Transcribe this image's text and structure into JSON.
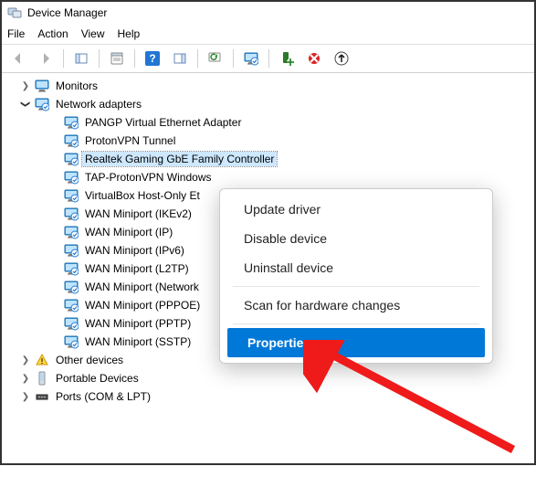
{
  "window": {
    "title": "Device Manager"
  },
  "menu": {
    "file": "File",
    "action": "Action",
    "view": "View",
    "help": "Help"
  },
  "tree": {
    "monitors": "Monitors",
    "network_adapters": "Network adapters",
    "adapters": [
      "PANGP Virtual Ethernet Adapter",
      "ProtonVPN Tunnel",
      "Realtek Gaming GbE Family Controller",
      "TAP-ProtonVPN Windows",
      "VirtualBox Host-Only Et",
      "WAN Miniport (IKEv2)",
      "WAN Miniport (IP)",
      "WAN Miniport (IPv6)",
      "WAN Miniport (L2TP)",
      "WAN Miniport (Network",
      "WAN Miniport (PPPOE)",
      "WAN Miniport (PPTP)",
      "WAN Miniport (SSTP)"
    ],
    "other_devices": "Other devices",
    "portable_devices": "Portable Devices",
    "ports": "Ports (COM & LPT)"
  },
  "context_menu": {
    "update": "Update driver",
    "disable": "Disable device",
    "uninstall": "Uninstall device",
    "scan": "Scan for hardware changes",
    "properties": "Properties"
  }
}
